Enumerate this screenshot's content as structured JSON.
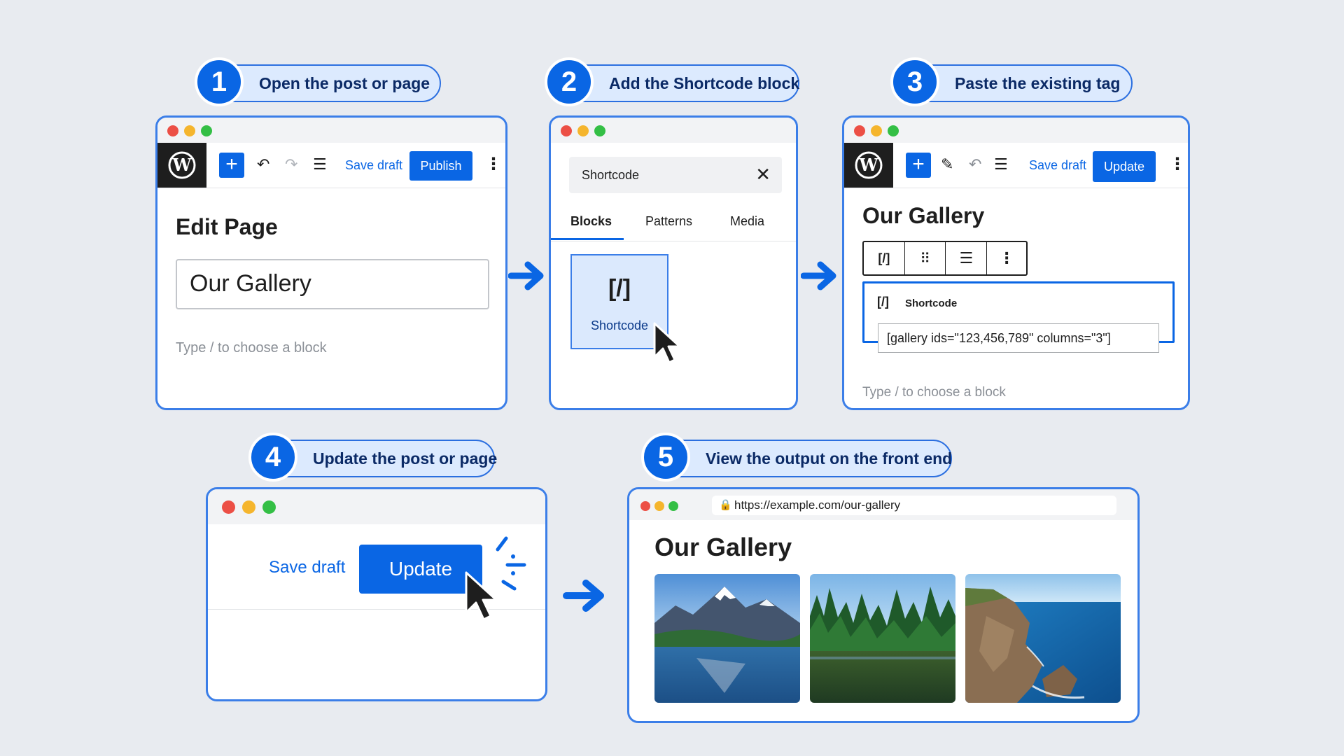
{
  "steps": [
    {
      "number": "1",
      "title": "Open the post or page"
    },
    {
      "number": "2",
      "title": "Add the Shortcode block"
    },
    {
      "number": "3",
      "title": "Paste the existing tag"
    },
    {
      "number": "4",
      "title": "Update the post or page"
    },
    {
      "number": "5",
      "title": "View the output on the front end"
    }
  ],
  "step1": {
    "save_draft": "Save draft",
    "publish": "Publish",
    "heading": "Edit Page",
    "title_value": "Our Gallery",
    "placeholder": "Type / to choose a block"
  },
  "step2": {
    "search_value": "Shortcode",
    "tabs": [
      "Blocks",
      "Patterns",
      "Media"
    ],
    "block_icon": "[/]",
    "block_label": "Shortcode"
  },
  "step3": {
    "save_draft": "Save draft",
    "update": "Update",
    "title": "Our Gallery",
    "toolbar_icon": "[/]",
    "block_icon": "[/]",
    "block_label": "Shortcode",
    "shortcode_value": "[gallery ids=\"123,456,789\" columns=\"3\"]",
    "placeholder": "Type / to choose a block"
  },
  "step4": {
    "save_draft": "Save draft",
    "update": "Update"
  },
  "step5": {
    "url": "https://example.com/our-gallery",
    "title": "Our Gallery",
    "images": [
      "mountain-lake-image",
      "forest-lake-image",
      "coastal-cliffs-image"
    ]
  },
  "colors": {
    "accent": "#0a66e4",
    "background": "#e8ebf0",
    "pill_bg": "#dceafe",
    "pill_text": "#0b2a66",
    "window_border": "#3b7ee8"
  }
}
